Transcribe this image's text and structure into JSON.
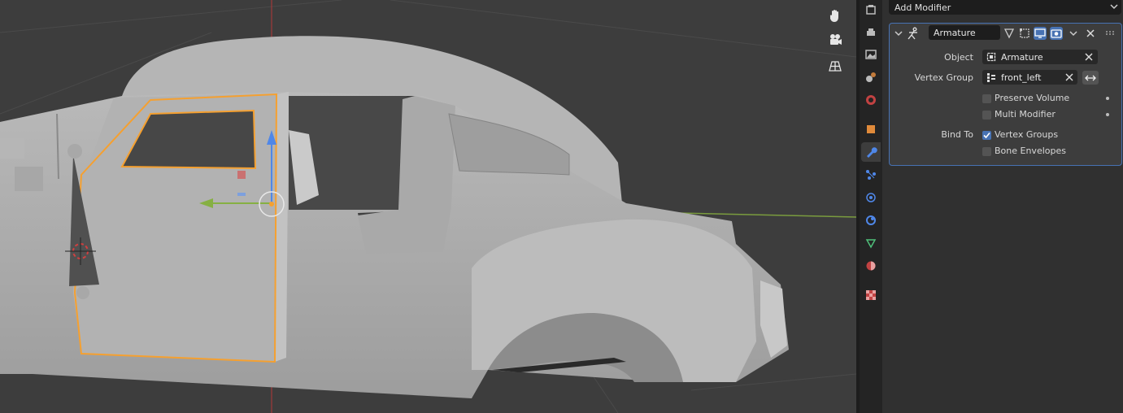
{
  "properties": {
    "add_modifier_label": "Add Modifier",
    "modifier": {
      "name": "Armature",
      "object_label": "Object",
      "object_value": "Armature",
      "vertex_group_label": "Vertex Group",
      "vertex_group_value": "front_left",
      "preserve_volume_label": "Preserve Volume",
      "preserve_volume_checked": false,
      "multi_modifier_label": "Multi Modifier",
      "multi_modifier_checked": false,
      "bind_to_label": "Bind To",
      "vertex_groups_label": "Vertex Groups",
      "vertex_groups_checked": true,
      "bone_envelopes_label": "Bone Envelopes",
      "bone_envelopes_checked": false
    }
  },
  "viewport": {
    "nav_icons": [
      "hand-pan-icon",
      "camera-icon",
      "grid-ortho-icon"
    ]
  },
  "tabs": [
    {
      "name": "render-tab",
      "icon": "render-icon"
    },
    {
      "name": "output-tab",
      "icon": "printer-icon"
    },
    {
      "name": "view-layer-tab",
      "icon": "image-icon"
    },
    {
      "name": "scene-tab",
      "icon": "scene-icon"
    },
    {
      "name": "world-tab",
      "icon": "world-icon"
    },
    {
      "name": "object-tab",
      "icon": "object-cube-icon"
    },
    {
      "name": "modifier-tab",
      "icon": "wrench-icon",
      "active": true
    },
    {
      "name": "particles-tab",
      "icon": "particles-icon"
    },
    {
      "name": "physics-tab",
      "icon": "physics-icon"
    },
    {
      "name": "constraints-tab",
      "icon": "constraint-icon"
    },
    {
      "name": "data-tab",
      "icon": "mesh-data-icon"
    },
    {
      "name": "material-tab",
      "icon": "material-sphere-icon"
    },
    {
      "name": "texture-tab",
      "icon": "checker-icon"
    }
  ],
  "colors": {
    "accent_blue": "#4772b3",
    "selection_orange": "#f5a030",
    "x_axis": "#86b043",
    "z_axis": "#4f87e8"
  }
}
